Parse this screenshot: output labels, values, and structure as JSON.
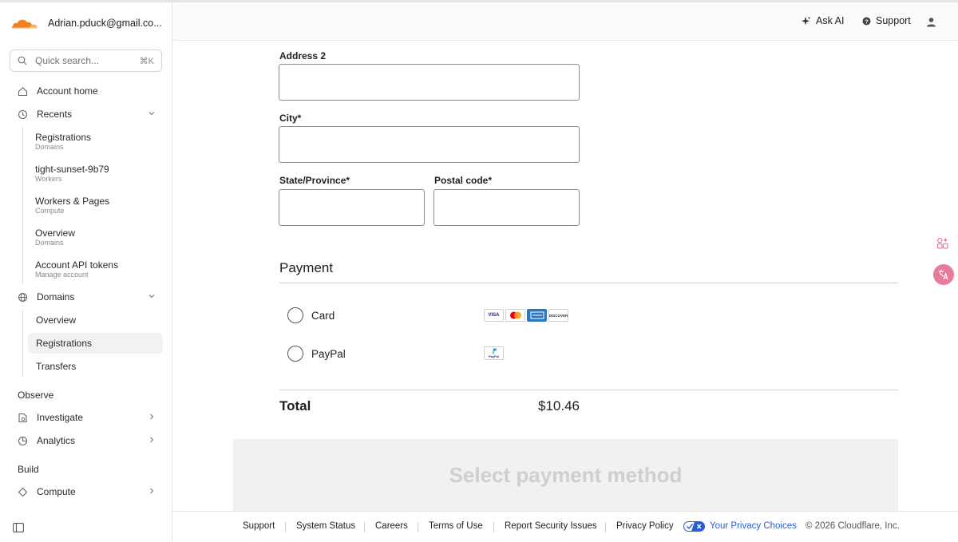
{
  "account": {
    "email": "Adrian.pduck@gmail.co..."
  },
  "search": {
    "placeholder": "Quick search...",
    "shortcut": "⌘K"
  },
  "sidebar": {
    "account_home": "Account home",
    "recents": {
      "label": "Recents",
      "items": [
        {
          "title": "Registrations",
          "subtitle": "Domains"
        },
        {
          "title": "tight-sunset-9b79",
          "subtitle": "Workers"
        },
        {
          "title": "Workers & Pages",
          "subtitle": "Compute"
        },
        {
          "title": "Overview",
          "subtitle": "Domains"
        },
        {
          "title": "Account API tokens",
          "subtitle": "Manage account"
        }
      ]
    },
    "domains": {
      "label": "Domains",
      "items": [
        "Overview",
        "Registrations",
        "Transfers"
      ],
      "active": "Registrations"
    },
    "observe_label": "Observe",
    "investigate": "Investigate",
    "analytics": "Analytics",
    "build_label": "Build",
    "compute": "Compute"
  },
  "header": {
    "ask_ai": "Ask AI",
    "support": "Support"
  },
  "form": {
    "address2_label": "Address 2",
    "address2_value": "",
    "city_label": "City*",
    "city_value": "",
    "state_label": "State/Province*",
    "state_value": "",
    "postal_label": "Postal code*",
    "postal_value": ""
  },
  "payment": {
    "title": "Payment",
    "options": [
      "Card",
      "PayPal"
    ],
    "card_brands": [
      "VISA",
      "Mastercard",
      "AMERICAN EXPRESS",
      "DISCOVER"
    ],
    "paypal_logo_text": "PayPal",
    "total_label": "Total",
    "total_value": "$10.46",
    "submit_label": "Select payment method"
  },
  "footer": {
    "links": [
      "Support",
      "System Status",
      "Careers",
      "Terms of Use",
      "Report Security Issues",
      "Privacy Policy"
    ],
    "privacy_choices": "Your Privacy Choices",
    "copyright": "© 2026 Cloudflare, Inc."
  },
  "colors": {
    "brand_orange": "#f38020",
    "link_blue": "#2a5bd7",
    "text": "#1f1f1f"
  }
}
